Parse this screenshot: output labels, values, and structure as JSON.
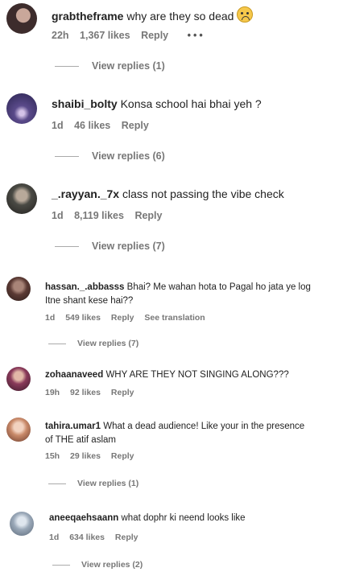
{
  "comments": [
    {
      "user": "grabtheframe",
      "text": "why are they so dead",
      "emoji": "loudly-crying-face-icon",
      "time": "22h",
      "likes": "1,367 likes",
      "reply": "Reply",
      "more": "•••",
      "view_replies": "View replies (1)"
    },
    {
      "user": "shaibi_bolty",
      "text": "Konsa school hai bhai yeh ?",
      "time": "1d",
      "likes": "46 likes",
      "reply": "Reply",
      "view_replies": "View replies (6)"
    },
    {
      "user": "_.rayyan._7x",
      "text": "class not passing the vibe check",
      "time": "1d",
      "likes": "8,119 likes",
      "reply": "Reply",
      "view_replies": "View replies (7)"
    },
    {
      "user": "hassan._.abbasss",
      "text": "Bhai? Me wahan hota to Pagal ho jata ye log",
      "text2": "Itne shant kese hai??",
      "time": "1d",
      "likes": "549 likes",
      "reply": "Reply",
      "translate": "See translation",
      "view_replies": "View replies (7)"
    },
    {
      "user": "zohaanaveed",
      "text": "WHY ARE THEY NOT SINGING ALONG???",
      "time": "19h",
      "likes": "92 likes",
      "reply": "Reply"
    },
    {
      "user": "tahira.umar1",
      "text": "What a dead audience! Like your in the presence",
      "text2": "of THE atif aslam",
      "time": "15h",
      "likes": "29 likes",
      "reply": "Reply",
      "view_replies": "View replies (1)"
    },
    {
      "user": "aneeqaehsaann",
      "text": "what dophr ki neend looks like",
      "time": "1d",
      "likes": "634 likes",
      "reply": "Reply",
      "view_replies": "View replies (2)"
    }
  ]
}
